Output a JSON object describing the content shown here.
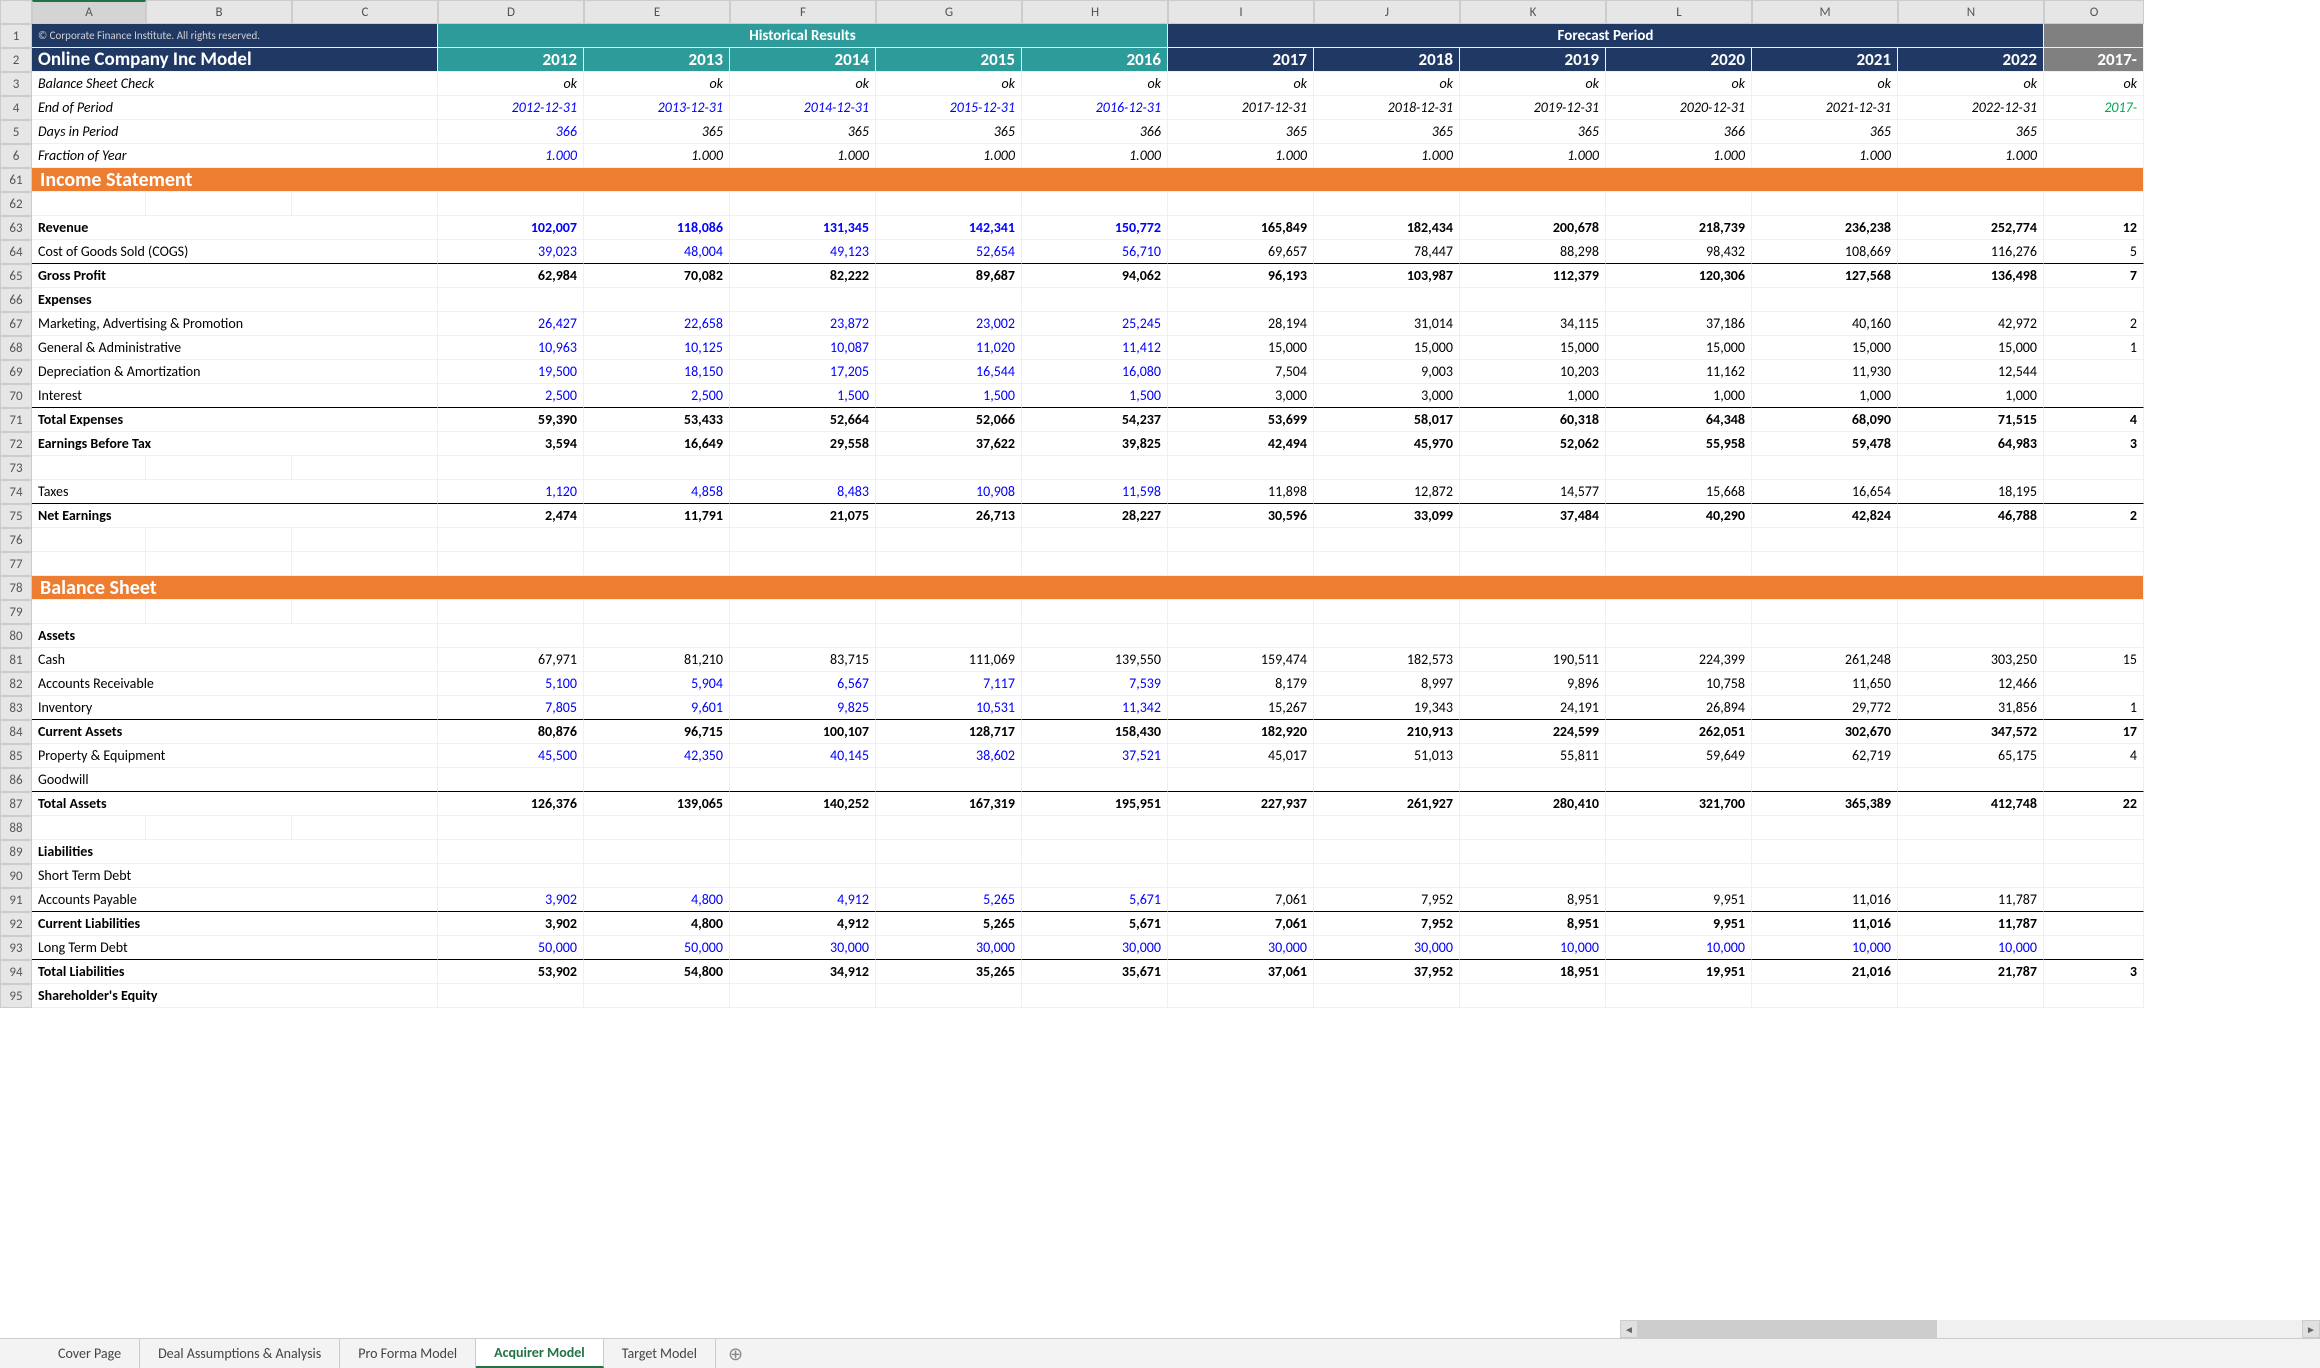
{
  "columns": [
    "A",
    "B",
    "C",
    "D",
    "E",
    "F",
    "G",
    "H",
    "I",
    "J",
    "K",
    "L",
    "M",
    "N",
    "O"
  ],
  "rownums": [
    "1",
    "2",
    "3",
    "4",
    "5",
    "6",
    "61",
    "62",
    "63",
    "64",
    "65",
    "66",
    "67",
    "68",
    "69",
    "70",
    "71",
    "72",
    "73",
    "74",
    "75",
    "76",
    "77",
    "78",
    "79",
    "80",
    "81",
    "82",
    "83",
    "84",
    "85",
    "86",
    "87",
    "88",
    "89",
    "90",
    "91",
    "92",
    "93",
    "94",
    "95"
  ],
  "copyright": "© Corporate Finance Institute. All rights reserved.",
  "title": "Online Company Inc Model",
  "hdr_historical": "Historical Results",
  "hdr_forecast": "Forecast Period",
  "years": [
    "2012",
    "2013",
    "2014",
    "2015",
    "2016",
    "2017",
    "2018",
    "2019",
    "2020",
    "2021",
    "2022"
  ],
  "o_year": "2017-",
  "o_date": "2017-",
  "labels": {
    "bsc": "Balance Sheet Check",
    "eop": "End of Period",
    "dip": "Days in Period",
    "foy": "Fraction of Year",
    "is": "Income Statement",
    "rev": "Revenue",
    "cogs": "Cost of Goods Sold (COGS)",
    "gp": "Gross Profit",
    "exp": "Expenses",
    "map": "Marketing, Advertising & Promotion",
    "ga": "General & Administrative",
    "da": "Depreciation & Amortization",
    "int": "Interest",
    "tex": "Total Expenses",
    "ebt": "Earnings Before Tax",
    "tax": "Taxes",
    "ne": "Net Earnings",
    "bs": "Balance Sheet",
    "assets": "Assets",
    "cash": "Cash",
    "ar": "Accounts Receivable",
    "inv": "Inventory",
    "ca": "Current Assets",
    "pe": "Property & Equipment",
    "gw": "Goodwill",
    "ta": "Total Assets",
    "liab": "Liabilities",
    "std": "Short Term Debt",
    "ap": "Accounts Payable",
    "cl": "Current Liabilities",
    "ltd": "Long Term Debt",
    "tl": "Total Liabilities",
    "se": "Shareholder's Equity"
  },
  "rows": {
    "ok": [
      "ok",
      "ok",
      "ok",
      "ok",
      "ok",
      "ok",
      "ok",
      "ok",
      "ok",
      "ok",
      "ok"
    ],
    "eop": [
      "2012-12-31",
      "2013-12-31",
      "2014-12-31",
      "2015-12-31",
      "2016-12-31",
      "2017-12-31",
      "2018-12-31",
      "2019-12-31",
      "2020-12-31",
      "2021-12-31",
      "2022-12-31"
    ],
    "dip": [
      "366",
      "365",
      "365",
      "365",
      "366",
      "365",
      "365",
      "365",
      "366",
      "365",
      "365"
    ],
    "foy": [
      "1.000",
      "1.000",
      "1.000",
      "1.000",
      "1.000",
      "1.000",
      "1.000",
      "1.000",
      "1.000",
      "1.000",
      "1.000"
    ],
    "rev": [
      "102,007",
      "118,086",
      "131,345",
      "142,341",
      "150,772",
      "165,849",
      "182,434",
      "200,678",
      "218,739",
      "236,238",
      "252,774"
    ],
    "cogs": [
      "39,023",
      "48,004",
      "49,123",
      "52,654",
      "56,710",
      "69,657",
      "78,447",
      "88,298",
      "98,432",
      "108,669",
      "116,276"
    ],
    "gp": [
      "62,984",
      "70,082",
      "82,222",
      "89,687",
      "94,062",
      "96,193",
      "103,987",
      "112,379",
      "120,306",
      "127,568",
      "136,498"
    ],
    "map": [
      "26,427",
      "22,658",
      "23,872",
      "23,002",
      "25,245",
      "28,194",
      "31,014",
      "34,115",
      "37,186",
      "40,160",
      "42,972"
    ],
    "ga": [
      "10,963",
      "10,125",
      "10,087",
      "11,020",
      "11,412",
      "15,000",
      "15,000",
      "15,000",
      "15,000",
      "15,000",
      "15,000"
    ],
    "da": [
      "19,500",
      "18,150",
      "17,205",
      "16,544",
      "16,080",
      "7,504",
      "9,003",
      "10,203",
      "11,162",
      "11,930",
      "12,544"
    ],
    "int": [
      "2,500",
      "2,500",
      "1,500",
      "1,500",
      "1,500",
      "3,000",
      "3,000",
      "1,000",
      "1,000",
      "1,000",
      "1,000"
    ],
    "tex": [
      "59,390",
      "53,433",
      "52,664",
      "52,066",
      "54,237",
      "53,699",
      "58,017",
      "60,318",
      "64,348",
      "68,090",
      "71,515"
    ],
    "ebt": [
      "3,594",
      "16,649",
      "29,558",
      "37,622",
      "39,825",
      "42,494",
      "45,970",
      "52,062",
      "55,958",
      "59,478",
      "64,983"
    ],
    "tax": [
      "1,120",
      "4,858",
      "8,483",
      "10,908",
      "11,598",
      "11,898",
      "12,872",
      "14,577",
      "15,668",
      "16,654",
      "18,195"
    ],
    "ne": [
      "2,474",
      "11,791",
      "21,075",
      "26,713",
      "28,227",
      "30,596",
      "33,099",
      "37,484",
      "40,290",
      "42,824",
      "46,788"
    ],
    "cash": [
      "67,971",
      "81,210",
      "83,715",
      "111,069",
      "139,550",
      "159,474",
      "182,573",
      "190,511",
      "224,399",
      "261,248",
      "303,250"
    ],
    "ar": [
      "5,100",
      "5,904",
      "6,567",
      "7,117",
      "7,539",
      "8,179",
      "8,997",
      "9,896",
      "10,758",
      "11,650",
      "12,466"
    ],
    "inv": [
      "7,805",
      "9,601",
      "9,825",
      "10,531",
      "11,342",
      "15,267",
      "19,343",
      "24,191",
      "26,894",
      "29,772",
      "31,856"
    ],
    "ca": [
      "80,876",
      "96,715",
      "100,107",
      "128,717",
      "158,430",
      "182,920",
      "210,913",
      "224,599",
      "262,051",
      "302,670",
      "347,572"
    ],
    "pe": [
      "45,500",
      "42,350",
      "40,145",
      "38,602",
      "37,521",
      "45,017",
      "51,013",
      "55,811",
      "59,649",
      "62,719",
      "65,175"
    ],
    "ta": [
      "126,376",
      "139,065",
      "140,252",
      "167,319",
      "195,951",
      "227,937",
      "261,927",
      "280,410",
      "321,700",
      "365,389",
      "412,748"
    ],
    "ap": [
      "3,902",
      "4,800",
      "4,912",
      "5,265",
      "5,671",
      "7,061",
      "7,952",
      "8,951",
      "9,951",
      "11,016",
      "11,787"
    ],
    "cl": [
      "3,902",
      "4,800",
      "4,912",
      "5,265",
      "5,671",
      "7,061",
      "7,952",
      "8,951",
      "9,951",
      "11,016",
      "11,787"
    ],
    "ltd": [
      "50,000",
      "50,000",
      "30,000",
      "30,000",
      "30,000",
      "30,000",
      "30,000",
      "10,000",
      "10,000",
      "10,000",
      "10,000"
    ],
    "tl": [
      "53,902",
      "54,800",
      "34,912",
      "35,265",
      "35,671",
      "37,061",
      "37,952",
      "18,951",
      "19,951",
      "21,016",
      "21,787"
    ]
  },
  "o_vals": {
    "rev": "12",
    "cogs": "5",
    "gp": "7",
    "map": "2",
    "ga": "1",
    "da": "",
    "int": "",
    "tex": "4",
    "ebt": "3",
    "tax": "",
    "ne": "2",
    "cash": "15",
    "ar": "",
    "inv": "1",
    "ca": "17",
    "pe": "4",
    "ta": "22",
    "ap": "",
    "cl": "",
    "ltd": "",
    "tl": "3"
  },
  "tabs": [
    "Cover Page",
    "Deal Assumptions & Analysis",
    "Pro Forma Model",
    "Acquirer Model",
    "Target Model"
  ],
  "active_tab": 3
}
